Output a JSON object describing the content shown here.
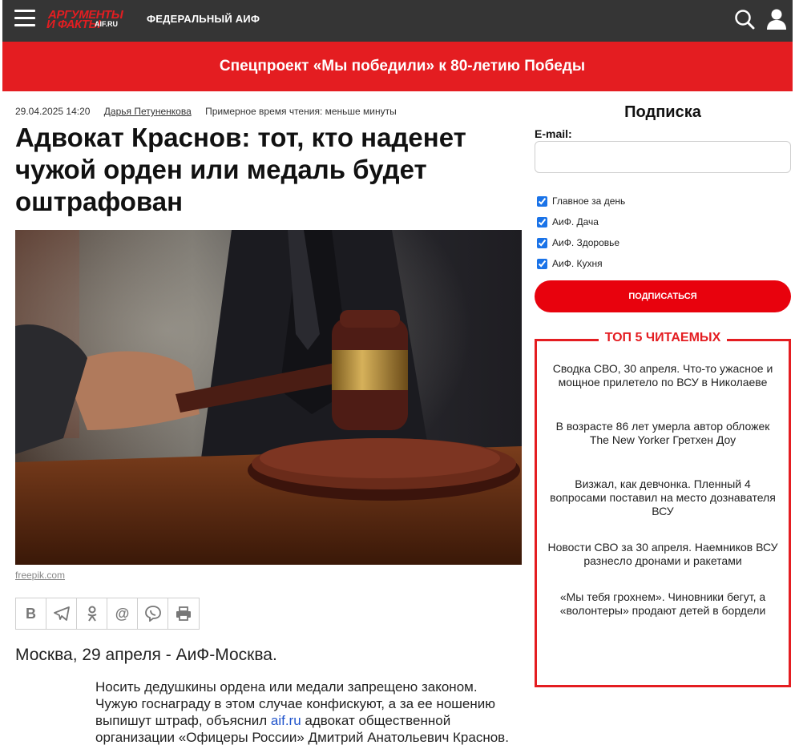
{
  "header": {
    "logo_line1": "АРГУМЕНТЫ",
    "logo_line2": "И ФАКТЫ",
    "logo_domain": "AIF.RU",
    "section": "ФЕДЕРАЛЬНЫЙ АИФ",
    "menu_icon": "hamburger-icon",
    "search_icon": "search-icon",
    "user_icon": "user-icon"
  },
  "banner": {
    "text": "Спецпроект «Мы победили» к 80-летию Победы"
  },
  "article": {
    "date": "29.04.2025 14:20",
    "author": "Дарья Петуненкова",
    "reading_time": "Примерное время чтения: меньше минуты",
    "title": "Адвокат Краснов: тот, кто наденет чужой орден или медаль будет оштрафован",
    "photo_credit": "freepik.com",
    "share": [
      "В",
      "telegram",
      "ok",
      "@",
      "viber",
      "print"
    ],
    "dateline": "Москва, 29 апреля - АиФ-Москва.",
    "lead_before": "Носить дедушкины ордена или медали запрещено законом. Чужую госнаграду в этом случае конфискуют, а за ее ношению выпишут штраф, объяснил ",
    "lead_link": "aif.ru",
    "lead_after": " адвокат общественной организации «Офицеры России» Дмитрий Анатольевич Краснов."
  },
  "subscription": {
    "title": "Подписка",
    "email_label": "E-mail:",
    "email_value": "",
    "options": [
      {
        "label": "Главное за день",
        "checked": true
      },
      {
        "label": "АиФ. Дача",
        "checked": true
      },
      {
        "label": "АиФ. Здоровье",
        "checked": true
      },
      {
        "label": "АиФ. Кухня",
        "checked": true
      }
    ],
    "button": "ПОДПИСАТЬСЯ"
  },
  "top5": {
    "title": "ТОП 5 ЧИТАЕМЫХ",
    "items": [
      "Сводка СВО, 30 апреля. Что-то ужасное и мощное прилетело по ВСУ в Николаеве",
      "В возрасте 86 лет умерла автор обложек The New Yorker Гретхен Доу",
      "Визжал, как девчонка. Пленный 4 вопросами поставил на место дознавателя ВСУ",
      "Новости СВО за 30 апреля. Наемников ВСУ разнесло дронами и ракетами",
      "«Мы тебя грохнем». Чиновники бегут, а «волонтеры» продают детей в бордели"
    ]
  },
  "colors": {
    "brand_red": "#e41d21",
    "header_bg": "#353535",
    "link_blue": "#2255cc"
  }
}
